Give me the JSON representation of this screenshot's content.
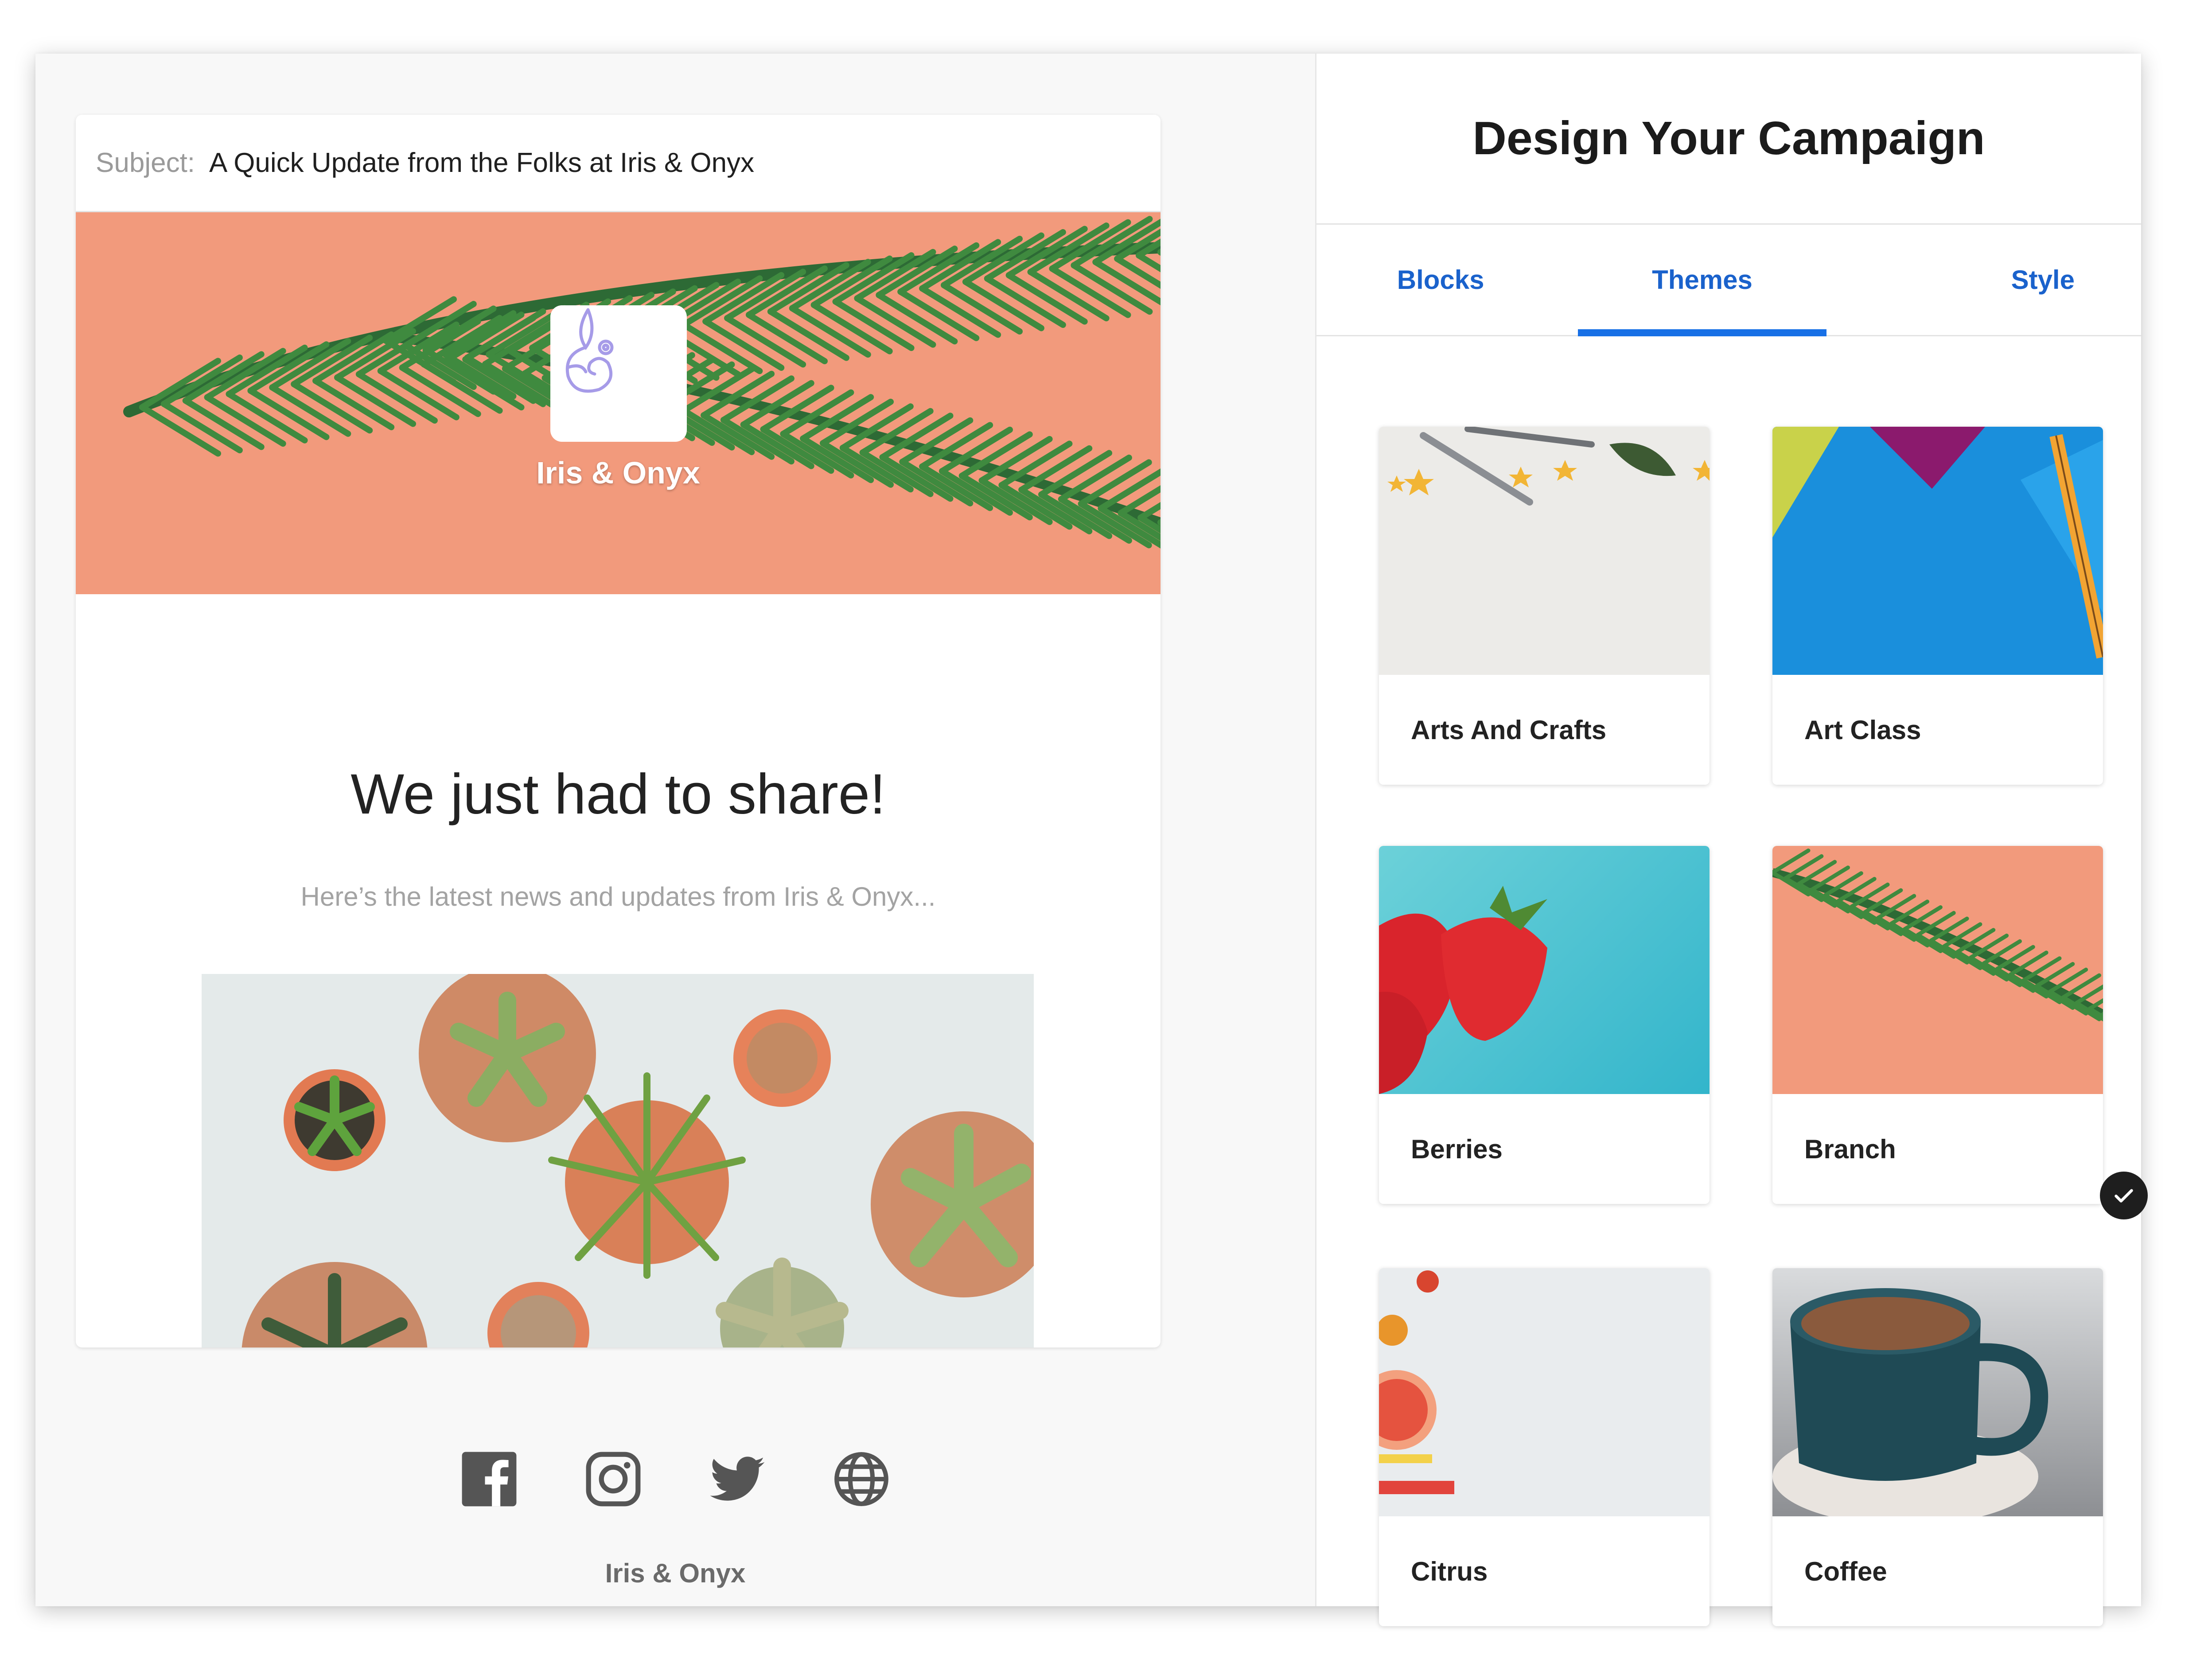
{
  "preview": {
    "subject_label": "Subject:",
    "subject_text": "A Quick Update from the Folks at Iris & Onyx",
    "brand_name": "Iris & Onyx",
    "headline": "We just had to share!",
    "subheadline": "Here’s the latest news and updates from Iris & Onyx...",
    "social_icons": [
      "facebook-icon",
      "instagram-icon",
      "twitter-icon",
      "globe-icon"
    ],
    "footer_brand": "Iris & Onyx"
  },
  "panel": {
    "title": "Design Your Campaign",
    "tabs": [
      {
        "label": "Blocks",
        "active": false
      },
      {
        "label": "Themes",
        "active": true
      },
      {
        "label": "Style",
        "active": false
      }
    ],
    "themes": [
      {
        "name": "Arts And Crafts",
        "selected": false
      },
      {
        "name": "Art Class",
        "selected": false
      },
      {
        "name": "Berries",
        "selected": false
      },
      {
        "name": "Branch",
        "selected": true
      },
      {
        "name": "Citrus",
        "selected": false
      },
      {
        "name": "Coffee",
        "selected": false
      }
    ]
  },
  "colors": {
    "accent": "#1870e6",
    "tab_text": "#1a62cc",
    "hero_bg": "#f29a7c",
    "branch_green": "#2f6a36"
  }
}
